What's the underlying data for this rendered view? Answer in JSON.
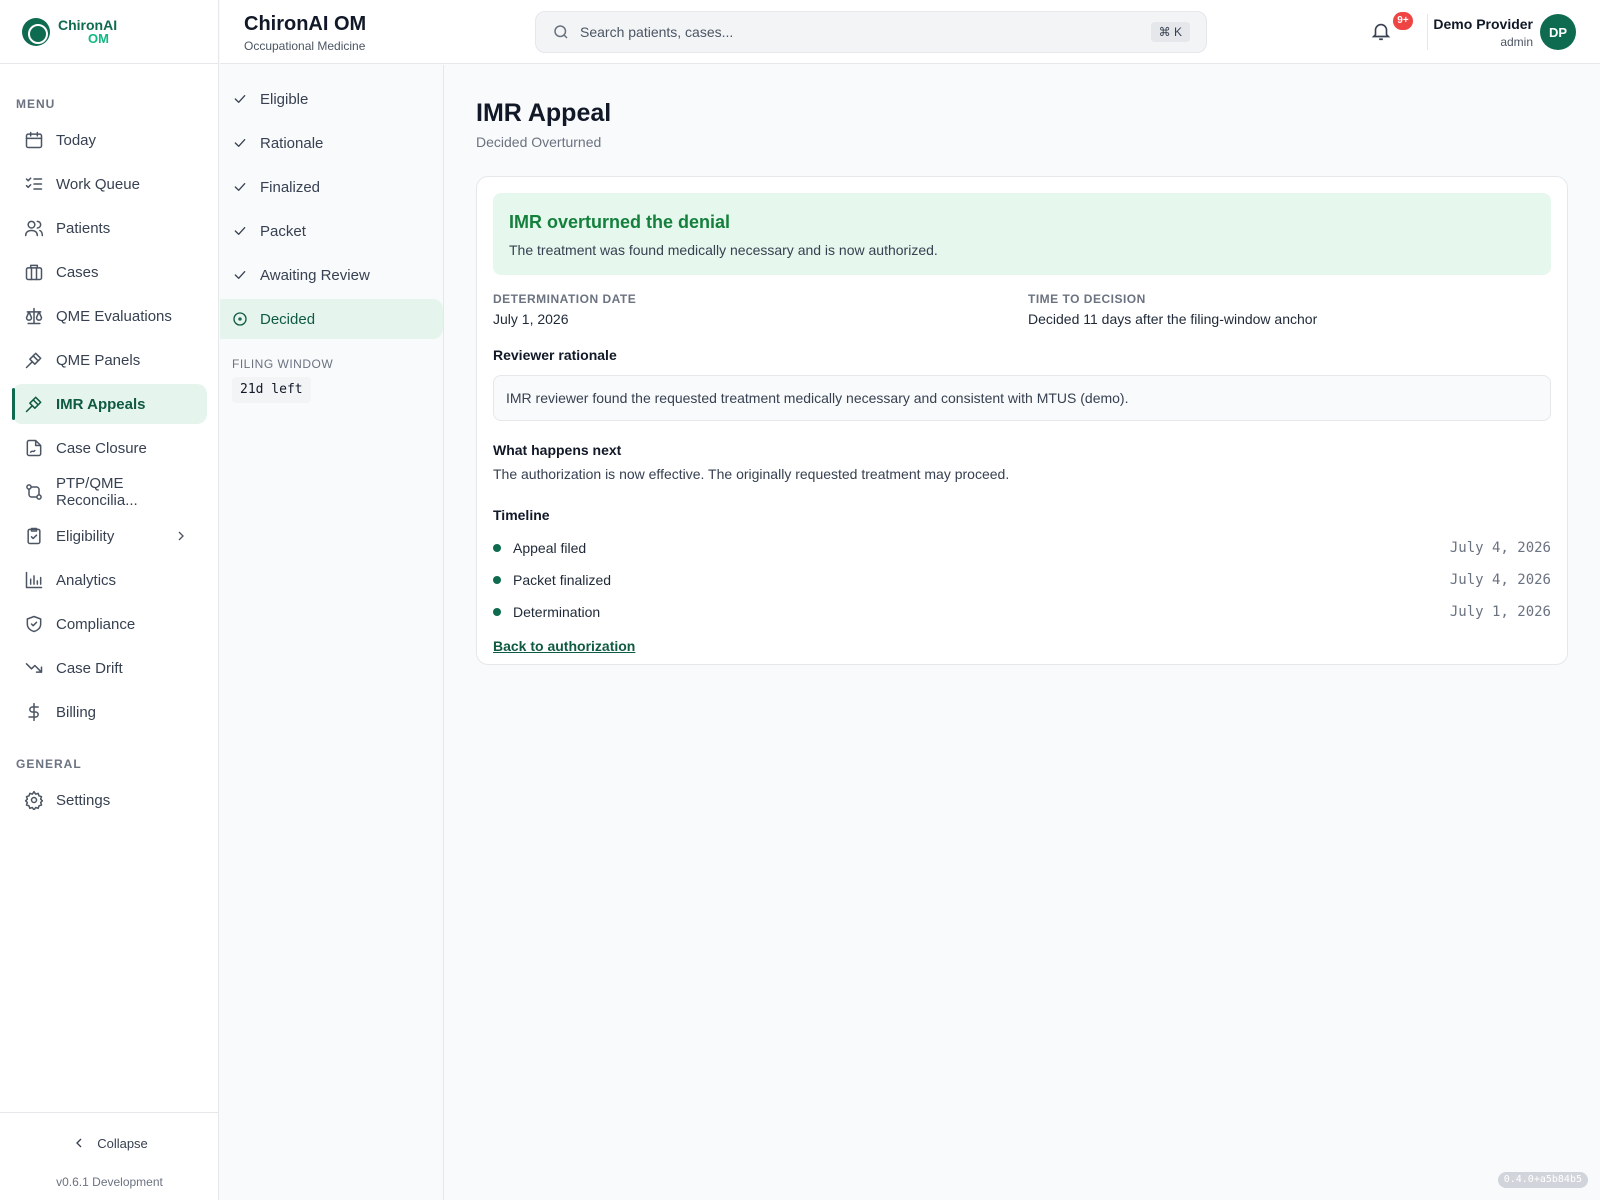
{
  "brand": {
    "name_line1": "ChironAI",
    "name_line2": "OM"
  },
  "sidebar": {
    "menu_label": "MENU",
    "items": [
      {
        "label": "Today",
        "icon": "calendar-icon"
      },
      {
        "label": "Work Queue",
        "icon": "list-checks-icon"
      },
      {
        "label": "Patients",
        "icon": "users-icon"
      },
      {
        "label": "Cases",
        "icon": "briefcase-icon"
      },
      {
        "label": "QME Evaluations",
        "icon": "scale-icon"
      },
      {
        "label": "QME Panels",
        "icon": "gavel-icon"
      },
      {
        "label": "IMR Appeals",
        "icon": "gavel-icon",
        "active": true
      },
      {
        "label": "Case Closure",
        "icon": "file-signature-icon"
      },
      {
        "label": "PTP/QME Reconcilia...",
        "icon": "git-compare-icon"
      },
      {
        "label": "Eligibility",
        "icon": "clipboard-check-icon",
        "has_submenu": true
      },
      {
        "label": "Analytics",
        "icon": "bar-chart-icon"
      },
      {
        "label": "Compliance",
        "icon": "shield-check-icon"
      },
      {
        "label": "Case Drift",
        "icon": "trending-down-icon"
      },
      {
        "label": "Billing",
        "icon": "dollar-icon"
      }
    ],
    "general_label": "GENERAL",
    "general_items": [
      {
        "label": "Settings",
        "icon": "gear-icon"
      }
    ],
    "collapse_label": "Collapse",
    "version": "v0.6.1 Development"
  },
  "header": {
    "title": "ChironAI OM",
    "subtitle": "Occupational Medicine",
    "search_placeholder": "Search patients, cases...",
    "search_shortcut": "⌘ K",
    "notification_badge": "9+",
    "user_name": "Demo Provider",
    "user_role": "admin",
    "avatar_initials": "DP"
  },
  "steps": {
    "items": [
      {
        "label": "Eligible",
        "state": "done"
      },
      {
        "label": "Rationale",
        "state": "done"
      },
      {
        "label": "Finalized",
        "state": "done"
      },
      {
        "label": "Packet",
        "state": "done"
      },
      {
        "label": "Awaiting Review",
        "state": "done"
      },
      {
        "label": "Decided",
        "state": "current"
      }
    ],
    "filing_window_label": "FILING WINDOW",
    "filing_window_value": "21d left"
  },
  "main": {
    "title": "IMR Appeal",
    "subtitle": "Decided Overturned",
    "banner": {
      "title": "IMR overturned the denial",
      "text": "The treatment was found medically necessary and is now authorized."
    },
    "determination_label": "DETERMINATION DATE",
    "determination_value": "July 1, 2026",
    "time_label": "TIME TO DECISION",
    "time_value": "Decided 11 days after the filing-window anchor",
    "rationale_title": "Reviewer rationale",
    "rationale_text": "IMR reviewer found the requested treatment medically necessary and consistent with MTUS (demo).",
    "next_title": "What happens next",
    "next_text": "The authorization is now effective. The originally requested treatment may proceed.",
    "timeline_title": "Timeline",
    "timeline": [
      {
        "label": "Appeal filed",
        "date": "July 4, 2026"
      },
      {
        "label": "Packet finalized",
        "date": "July 4, 2026"
      },
      {
        "label": "Determination",
        "date": "July 1, 2026"
      }
    ],
    "back_link": "Back to authorization"
  },
  "build_tag": "0.4.0+a5b84b5",
  "colors": {
    "accent": "#0f6b4f",
    "success_bg": "#e6f7ed",
    "success_text": "#15803d",
    "badge": "#ef4444"
  }
}
